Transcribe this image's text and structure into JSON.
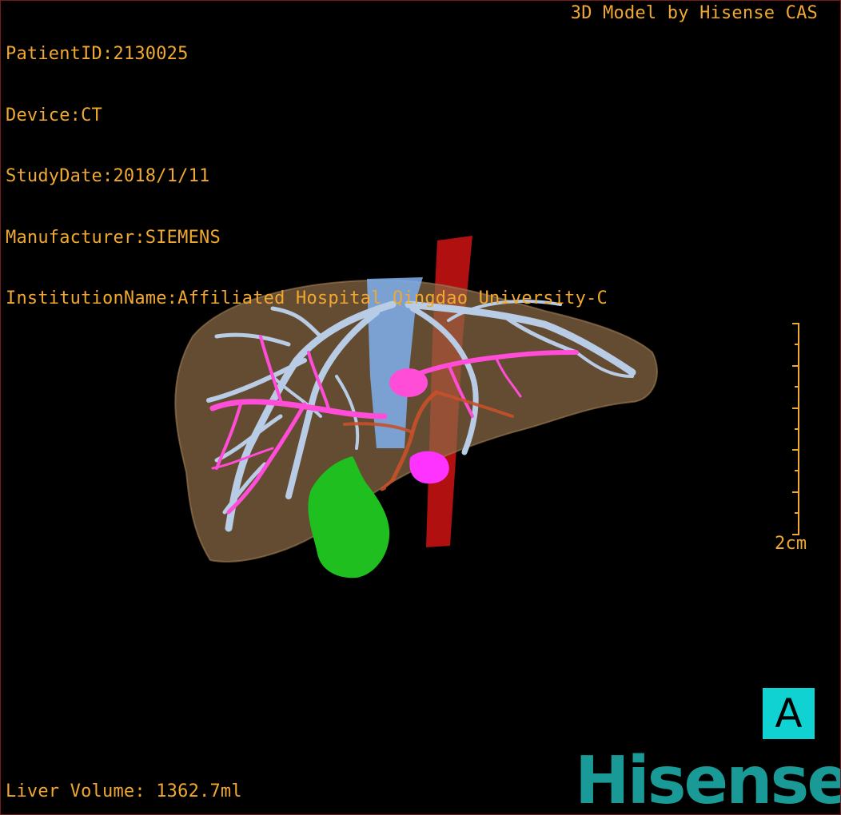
{
  "header": {
    "patient_id": "PatientID:2130025",
    "device": "Device:CT",
    "study_date": "StudyDate:2018/1/11",
    "manufacturer": "Manufacturer:SIEMENS",
    "institution": "InstitutionName:Affiliated Hospital Qingdao University-C"
  },
  "credit": "3D Model by Hisense CAS",
  "scale": {
    "label": "2cm"
  },
  "orientation": {
    "label": "A"
  },
  "footer": {
    "liver_volume": "Liver Volume: 1362.7ml"
  },
  "brand": {
    "logo_text": "Hisense"
  },
  "colors": {
    "overlay_text": "#f0a830",
    "liver": "#8a6a45",
    "hepatic_veins": "#b8cce6",
    "portal_vein": "#ff4dd8",
    "aorta": "#b01010",
    "hepatic_artery": "#c8502a",
    "ivc": "#7fb0f0",
    "gallbladder": "#1fbf1f",
    "lesion": "#ff33ff",
    "orientation_box": "#10d2d2",
    "logo": "#1a9a96"
  }
}
